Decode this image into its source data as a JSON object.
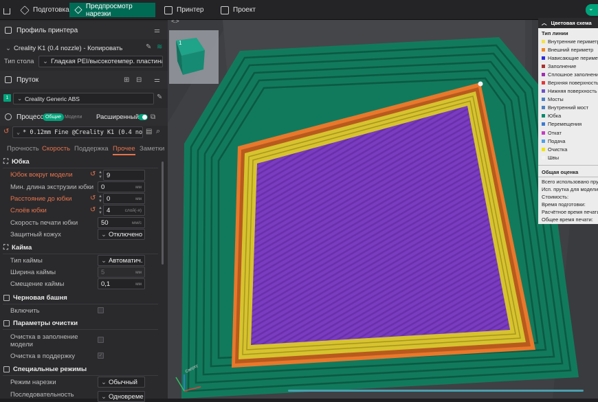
{
  "topbar": {
    "tabs": [
      {
        "label": "Подготовка"
      },
      {
        "label": "Предпросмотр нарезки"
      },
      {
        "label": "Принтер"
      },
      {
        "label": "Проект"
      }
    ]
  },
  "printer": {
    "header": "Профиль принтера",
    "profile": "Creality K1 (0.4 nozzle) - Копировать",
    "bed_label": "Тип стола",
    "bed_value": "Гладкая PEI/высокотемпер. пластина"
  },
  "filament": {
    "header": "Пруток",
    "slot": "1",
    "value": "Creality Generic ABS"
  },
  "process": {
    "header": "Процесс",
    "toggle_global": "Общие",
    "toggle_models": "Модели",
    "advanced": "Расширенный",
    "profile": "* 0.12mm Fine @Creality K1 (0.4 nozzle)",
    "tabs": [
      "Прочность",
      "Скорость",
      "Поддержка",
      "Прочее",
      "Заметки"
    ]
  },
  "settings": {
    "skirt": {
      "title": "Юбка",
      "loops_label": "Юбок вокруг модели",
      "loops_value": "9",
      "minlen_label": "Мин. длина экструзии юбки",
      "minlen_value": "0",
      "minlen_unit": "мм",
      "dist_label": "Расстояние до юбки",
      "dist_value": "0",
      "dist_unit": "мм",
      "layers_label": "Слоёв юбки",
      "layers_value": "4",
      "layers_unit": "слой(-я)",
      "speed_label": "Скорость печати юбки",
      "speed_value": "50",
      "speed_unit": "мм/с",
      "shield_label": "Защитный кожух",
      "shield_value": "Отключено"
    },
    "brim": {
      "title": "Кайма",
      "type_label": "Тип каймы",
      "type_value": "Автоматич.",
      "width_label": "Ширина каймы",
      "width_value": "5",
      "width_unit": "мм",
      "offset_label": "Смещение каймы",
      "offset_value": "0,1",
      "offset_unit": "мм"
    },
    "tower": {
      "title": "Черновая башня",
      "enable_label": "Включить"
    },
    "purge": {
      "title": "Параметры очистки",
      "infill_label_1": "Очистка в заполнение",
      "infill_label_2": "модели",
      "support_label": "Очистка в поддержку"
    },
    "special": {
      "title": "Специальные режимы",
      "mode_label": "Режим нарезки",
      "mode_value": "Обычный",
      "seq_label": "Последовательность",
      "seq_value": "Одновреме"
    }
  },
  "legend": {
    "header": "Цветовая схема",
    "line_type_title": "Тип линии",
    "items": [
      {
        "label": "Внутренние периметры",
        "color": "#f5e14a"
      },
      {
        "label": "Внешний периметр",
        "color": "#f08522"
      },
      {
        "label": "Нависающие периметры",
        "color": "#2a2ae0"
      },
      {
        "label": "Заполнение",
        "color": "#a83131"
      },
      {
        "label": "Сплошное заполнение",
        "color": "#9f2eb0"
      },
      {
        "label": "Верхняя поверхность",
        "color": "#e0383a"
      },
      {
        "label": "Нижняя поверхность",
        "color": "#6b52c8"
      },
      {
        "label": "Мосты",
        "color": "#4d7fc0"
      },
      {
        "label": "Внутренний мост",
        "color": "#4d7fc0"
      },
      {
        "label": "Юбка",
        "color": "#00896c"
      },
      {
        "label": "Перемещения",
        "color": "#3a7bd0"
      },
      {
        "label": "Откат",
        "color": "#c43ec4"
      },
      {
        "label": "Подача",
        "color": "#4fa0e6"
      },
      {
        "label": "Очистка",
        "color": "#f2e600"
      },
      {
        "label": "Швы",
        "color": "#f2f2f2"
      }
    ],
    "summary_title": "Общая оценка",
    "summary": [
      {
        "label": "Всего использовано прутка"
      },
      {
        "label": "Исп. прутка для модели"
      },
      {
        "label": "Стоимость:"
      },
      {
        "label": "Время подготовки:"
      },
      {
        "label": "Расчётное время печати"
      },
      {
        "label": "Общее время печати:"
      }
    ]
  },
  "viewport": {
    "cube_label": "1",
    "axis_label": "Сверху"
  },
  "colors": {
    "accent": "#00a27a",
    "skirt": "#127a5c",
    "outer_perimeter": "#e8782b",
    "inner_perimeter": "#d6c32e",
    "solid_infill": "#7a3cc0",
    "changed_label": "#e8744a"
  }
}
